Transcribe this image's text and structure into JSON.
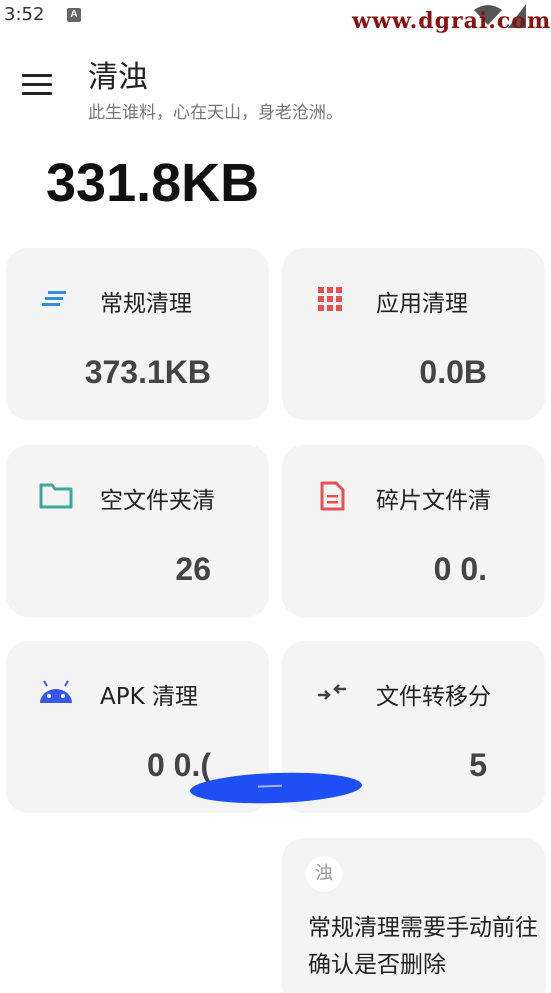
{
  "status_bar": {
    "time": "3:52",
    "a_badge": "A",
    "watermark": "www.dgrai.com"
  },
  "header": {
    "title": "清浊",
    "subtitle": "此生谁料，心在天山，身老沧洲。"
  },
  "summary": {
    "total_size": "331.8KB"
  },
  "cards": [
    {
      "label": "常规清理",
      "value": "373.1KB",
      "icon": "lines-icon",
      "color": "#2f8de4"
    },
    {
      "label": "应用清理",
      "value": "0.0B",
      "icon": "grid-icon",
      "color": "#e84f4f"
    },
    {
      "label": "空文件夹清",
      "value": "26",
      "icon": "folder-icon",
      "color": "#3aa89a"
    },
    {
      "label": "碎片文件清",
      "value": "0 0.",
      "icon": "document-icon",
      "color": "#e84f4f"
    },
    {
      "label": "APK 清理",
      "value": "0 0.(",
      "icon": "android-icon",
      "color": "#3657e8"
    },
    {
      "label": "文件转移分",
      "value": "5",
      "icon": "transfer-arrows-icon",
      "color": "#444444"
    }
  ],
  "tip": {
    "avatar_char": "浊",
    "text": "常规清理需要手动前往确认是否删除"
  }
}
